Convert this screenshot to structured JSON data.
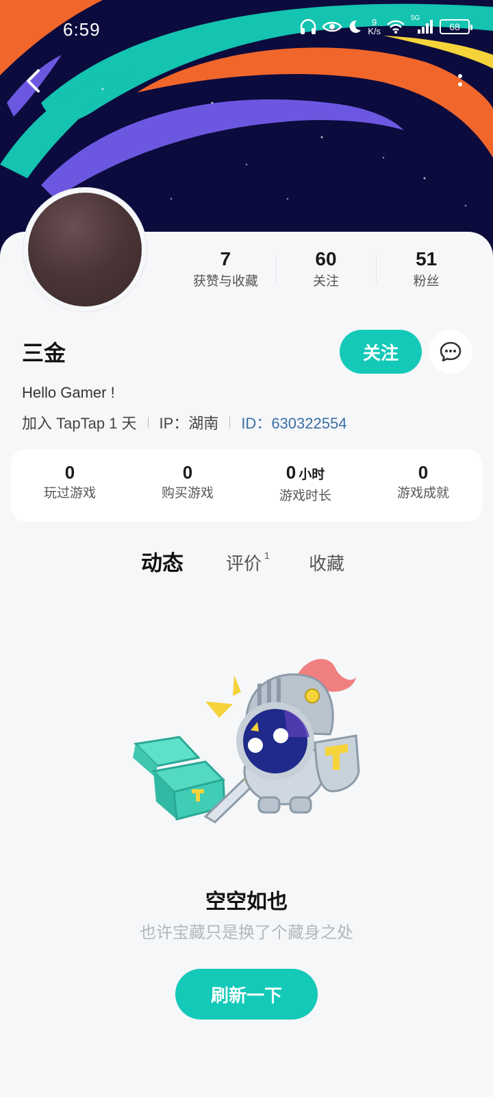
{
  "status_bar": {
    "time": "6:59",
    "net_speed_value": "9",
    "net_speed_unit": "K/s",
    "network_type": "5G",
    "battery": "68"
  },
  "profile": {
    "name": "三金",
    "bio": "Hello Gamer !",
    "joined": "加入 TapTap 1 天",
    "ip": "IP：湖南",
    "id": "ID：630322554",
    "follow_label": "关注"
  },
  "stats": [
    {
      "value": "7",
      "label": "获赞与收藏"
    },
    {
      "value": "60",
      "label": "关注"
    },
    {
      "value": "51",
      "label": "粉丝"
    }
  ],
  "game_stats": [
    {
      "value": "0",
      "unit": "",
      "label": "玩过游戏"
    },
    {
      "value": "0",
      "unit": "",
      "label": "购买游戏"
    },
    {
      "value": "0",
      "unit": "小时",
      "label": "游戏时长"
    },
    {
      "value": "0",
      "unit": "",
      "label": "游戏成就"
    }
  ],
  "tabs": [
    {
      "label": "动态",
      "badge": ""
    },
    {
      "label": "评价",
      "badge": "1"
    },
    {
      "label": "收藏",
      "badge": ""
    }
  ],
  "empty_state": {
    "title": "空空如也",
    "subtitle": "也许宝藏只是换了个藏身之处",
    "button": "刷新一下"
  },
  "colors": {
    "accent": "#15c9b9",
    "link": "#3b6ea5",
    "banner_bg": "#0c0b3d"
  }
}
